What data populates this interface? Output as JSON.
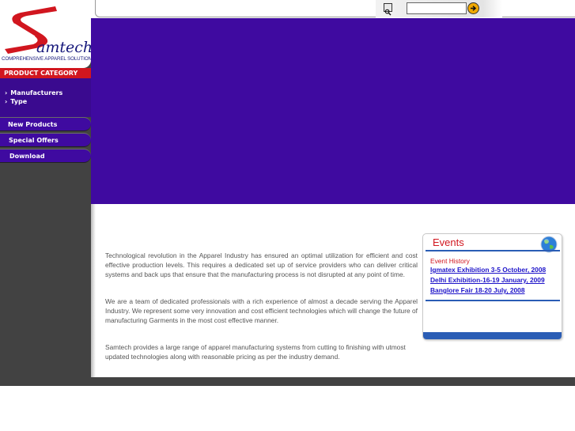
{
  "brand": {
    "wordmark": "amtech",
    "tagline": "COMPREHENSIVE APPAREL SOLUTIONS",
    "colors": {
      "red": "#d1161f",
      "navy": "#15177a"
    }
  },
  "sidebar": {
    "category_header": "PRODUCT CATEGORY",
    "categories": [
      {
        "label": "Manufacturers"
      },
      {
        "label": "Type"
      }
    ],
    "nav": [
      {
        "label": "New Products"
      },
      {
        "label": "Special Offers"
      },
      {
        "label": "Download"
      }
    ]
  },
  "search": {
    "value": "",
    "icons": {
      "left": "magnifier-icon",
      "submit": "arrow-right-circle-icon"
    }
  },
  "banner": {
    "color": "#3f0aa0"
  },
  "content": {
    "paragraphs": [
      "Technological revolution in the Apparel Industry has ensured an optimal utilization for efficient and cost effective production levels. This requires a dedicated set up of service providers who can deliver critical systems and back ups that ensure that the manufacturing process is not disrupted at any point of time.",
      "We are a team of dedicated professionals with a rich experience of almost a decade serving the Apparel Industry. We represent some very innovation and cost efficient technologies which will change the future of manufacturing Garments in the most cost effective manner.",
      "Samtech provides a large range of apparel manufacturing systems from cutting to finishing with utmost updated technologies along with reasonable pricing as per the industry demand."
    ]
  },
  "events": {
    "title": "Events",
    "subtitle": "Event History",
    "items": [
      {
        "label": "Igmatex Exhibition 3-5 October, 2008"
      },
      {
        "label": "Delhi Exhibition-16-19 January, 2009"
      },
      {
        "label": "Banglore Fair 18-20 July, 2008"
      }
    ],
    "icon": "globe-icon"
  }
}
